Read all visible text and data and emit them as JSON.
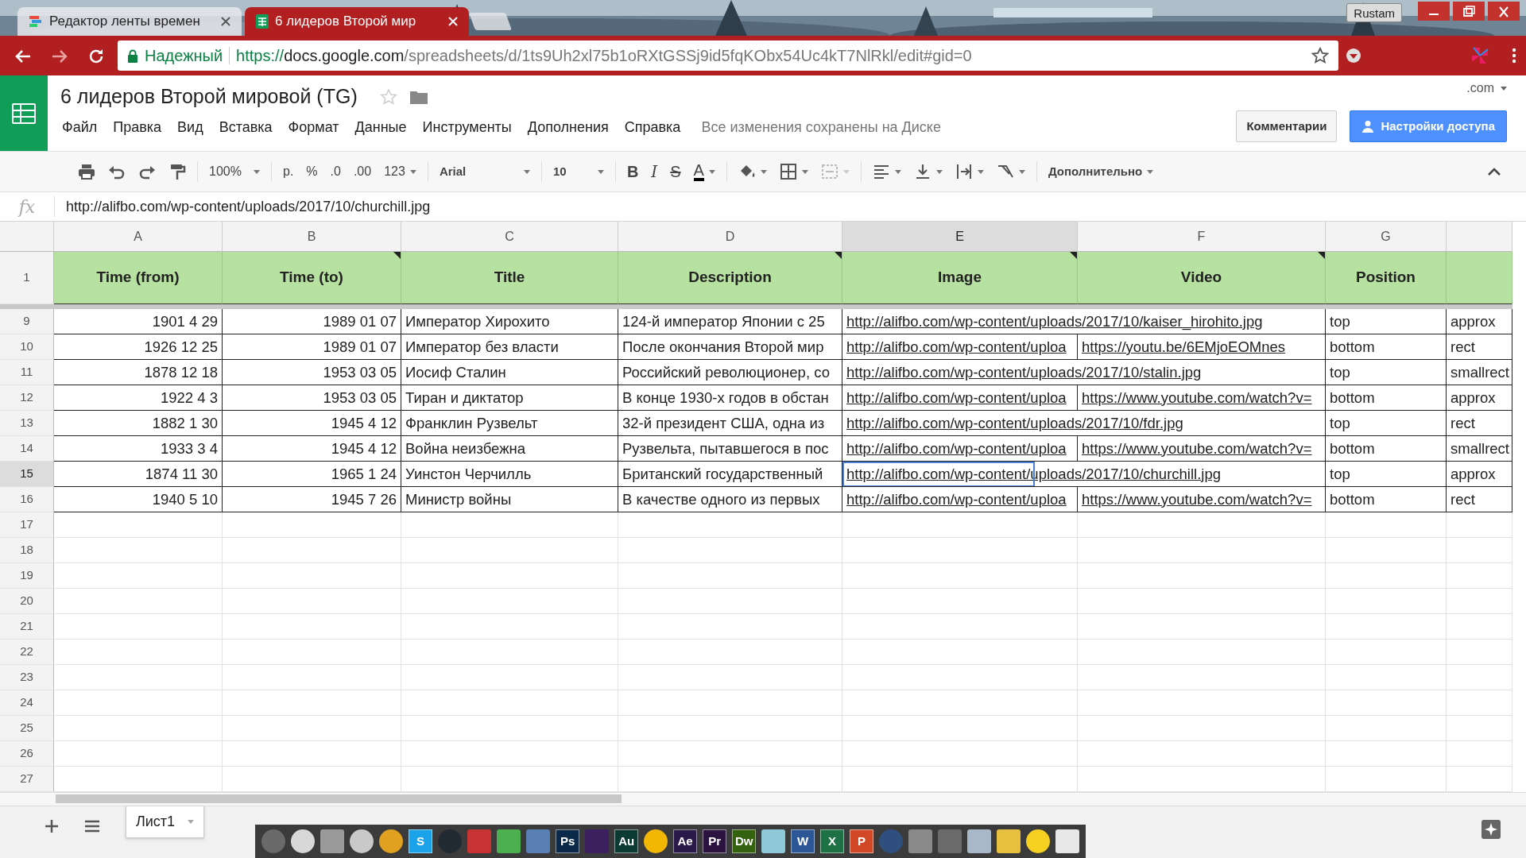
{
  "browser": {
    "tabs": [
      {
        "title": "Редактор ленты времен",
        "selected": false
      },
      {
        "title": "6 лидеров Второй мир",
        "selected": true
      }
    ],
    "user": "Rustam",
    "secure_label": "Надежный",
    "url": {
      "scheme": "https://",
      "host": "docs.google.com",
      "path": "/spreadsheets/d/1ts9Uh2xl75b1oRXtGSSj9id5fqKObx54Uc4kT7NlRkl/edit#gid=0"
    }
  },
  "doc": {
    "title": "6 лидеров Второй мировой (TG)",
    "starred": false,
    "menu": [
      "Файл",
      "Правка",
      "Вид",
      "Вставка",
      "Формат",
      "Данные",
      "Инструменты",
      "Дополнения",
      "Справка"
    ],
    "save_status": "Все изменения сохранены на Диске",
    "account": ".com",
    "comments_button": "Комментарии",
    "share_button": "Настройки доступа"
  },
  "toolbar": {
    "zoom": "100%",
    "currency": "р.",
    "percent": "%",
    "decrease_decimals": ".0",
    "increase_decimals": ".00",
    "more_formats": "123",
    "font": "Arial",
    "font_size": "10",
    "bold": "B",
    "italic": "I",
    "strike": "S",
    "text_color": "A",
    "more": "Дополнительно"
  },
  "formula_bar": {
    "label": "fx",
    "value": "http://alifbo.com/wp-content/uploads/2017/10/churchill.jpg"
  },
  "sheet": {
    "columns": [
      {
        "letter": "A",
        "selected": false
      },
      {
        "letter": "B",
        "selected": false
      },
      {
        "letter": "C",
        "selected": false
      },
      {
        "letter": "D",
        "selected": false
      },
      {
        "letter": "E",
        "selected": true
      },
      {
        "letter": "F",
        "selected": false
      },
      {
        "letter": "G",
        "selected": false
      },
      {}
    ],
    "header_row": {
      "number": "1",
      "cells": [
        {
          "text": "Time (from)",
          "note": false
        },
        {
          "text": "Time (to)",
          "note": true
        },
        {
          "text": "Title",
          "note": false
        },
        {
          "text": "Description",
          "note": true
        },
        {
          "text": "Image",
          "note": true
        },
        {
          "text": "Video",
          "note": true
        },
        {
          "text": "Position",
          "note": false
        }
      ]
    },
    "rows": [
      {
        "number": "9",
        "selected": false,
        "cells": {
          "a": "1901 4 29",
          "b": "1989 01 07",
          "c": "Император Хирохито",
          "d": "124-й император Японии с 25",
          "e": "http://alifbo.com/wp-content/uploads/2017/10/kaiser_hirohito.jpg",
          "g": "top",
          "h": "approx"
        }
      },
      {
        "number": "10",
        "selected": false,
        "cells": {
          "a": "1926 12 25",
          "b": "1989 01 07",
          "c": "Император без власти",
          "d": "После окончания Второй мир",
          "e": "http://alifbo.com/wp-content/uploa",
          "f": "https://youtu.be/6EMjoEOMnes",
          "g": "bottom",
          "h": "rect"
        }
      },
      {
        "number": "11",
        "selected": false,
        "cells": {
          "a": "1878 12 18",
          "b": "1953 03 05",
          "c": "Иосиф Сталин",
          "d": "Российский революционер, со",
          "e": "http://alifbo.com/wp-content/uploads/2017/10/stalin.jpg",
          "g": "top",
          "h": "smallrect"
        }
      },
      {
        "number": "12",
        "selected": false,
        "cells": {
          "a": "1922 4 3",
          "b": "1953 03 05",
          "c": "Тиран и диктатор",
          "d": "В конце 1930-х годов в обстан",
          "e": "http://alifbo.com/wp-content/uploa",
          "f": "https://www.youtube.com/watch?v=",
          "g": "bottom",
          "h": "approx"
        }
      },
      {
        "number": "13",
        "selected": false,
        "cells": {
          "a": "1882 1 30",
          "b": "1945 4 12",
          "c": "Франклин Рузвельт",
          "d": "32-й президент США, одна из",
          "e": "http://alifbo.com/wp-content/uploads/2017/10/fdr.jpg",
          "g": "top",
          "h": "rect"
        }
      },
      {
        "number": "14",
        "selected": false,
        "cells": {
          "a": "1933 3 4",
          "b": "1945 4 12",
          "c": "Война неизбежна",
          "d": "Рузвельта, пытавшегося в пос",
          "e": "http://alifbo.com/wp-content/uploa",
          "f": "https://www.youtube.com/watch?v=",
          "g": "bottom",
          "h": "smallrect"
        }
      },
      {
        "number": "15",
        "selected": true,
        "cells": {
          "a": "1874 11 30",
          "b": "1965 1 24",
          "c": "Уинстон Черчилль",
          "d": "Британский государственный",
          "e": "http://alifbo.com/wp-content/uploads/2017/10/churchill.jpg",
          "g": "top",
          "h": "approx"
        }
      },
      {
        "number": "16",
        "selected": false,
        "cells": {
          "a": "1940 5 10",
          "b": "1945 7 26",
          "c": "Министр войны",
          "d": "В качестве одного из первых",
          "e": "http://alifbo.com/wp-content/uploa",
          "f": "https://www.youtube.com/watch?v=",
          "g": "bottom",
          "h": "rect"
        }
      },
      {
        "number": "17"
      },
      {
        "number": "18"
      },
      {
        "number": "19"
      },
      {
        "number": "20"
      },
      {
        "number": "21"
      },
      {
        "number": "22"
      },
      {
        "number": "23"
      },
      {
        "number": "24"
      },
      {
        "number": "25"
      },
      {
        "number": "26"
      },
      {
        "number": "27"
      }
    ]
  },
  "sheet_tabs": [
    {
      "label": "Лист1",
      "selected": true
    }
  ],
  "taskbar": {
    "apps": [
      {
        "kind": "round",
        "color": "#6a6a6a"
      },
      {
        "kind": "round",
        "color": "#d8d8d8"
      },
      {
        "kind": "square",
        "color": "#9a9a9a"
      },
      {
        "kind": "round",
        "color": "#c9c9c9"
      },
      {
        "kind": "round",
        "color": "#e0a020"
      },
      {
        "kind": "letters",
        "label": "S",
        "color": "#1aa3e8"
      },
      {
        "kind": "round",
        "color": "#222a33"
      },
      {
        "kind": "square",
        "color": "#c83232"
      },
      {
        "kind": "square",
        "color": "#4caf50"
      },
      {
        "kind": "square",
        "color": "#5a7fb5"
      },
      {
        "kind": "letters",
        "label": "Ps",
        "color": "#0b2a4a"
      },
      {
        "kind": "square",
        "color": "#3b1f5e"
      },
      {
        "kind": "letters",
        "label": "Au",
        "color": "#0d3b34"
      },
      {
        "kind": "round",
        "color": "#f2b705"
      },
      {
        "kind": "letters",
        "label": "Ae",
        "color": "#2a1a4a"
      },
      {
        "kind": "letters",
        "label": "Pr",
        "color": "#2b1340"
      },
      {
        "kind": "letters",
        "label": "Dw",
        "color": "#35620f"
      },
      {
        "kind": "square",
        "color": "#8fc9d9"
      },
      {
        "kind": "letters",
        "label": "W",
        "color": "#2b5797"
      },
      {
        "kind": "letters",
        "label": "X",
        "color": "#1e7145"
      },
      {
        "kind": "letters",
        "label": "P",
        "color": "#d24726"
      },
      {
        "kind": "round",
        "color": "#2f4f7f"
      },
      {
        "kind": "square",
        "color": "#8a8a8a"
      },
      {
        "kind": "square",
        "color": "#6b6b6b"
      },
      {
        "kind": "square",
        "color": "#a8b8c8"
      },
      {
        "kind": "square",
        "color": "#e8c040"
      },
      {
        "kind": "round",
        "color": "#f5d020"
      },
      {
        "kind": "square",
        "color": "#e8e8e8"
      }
    ]
  }
}
